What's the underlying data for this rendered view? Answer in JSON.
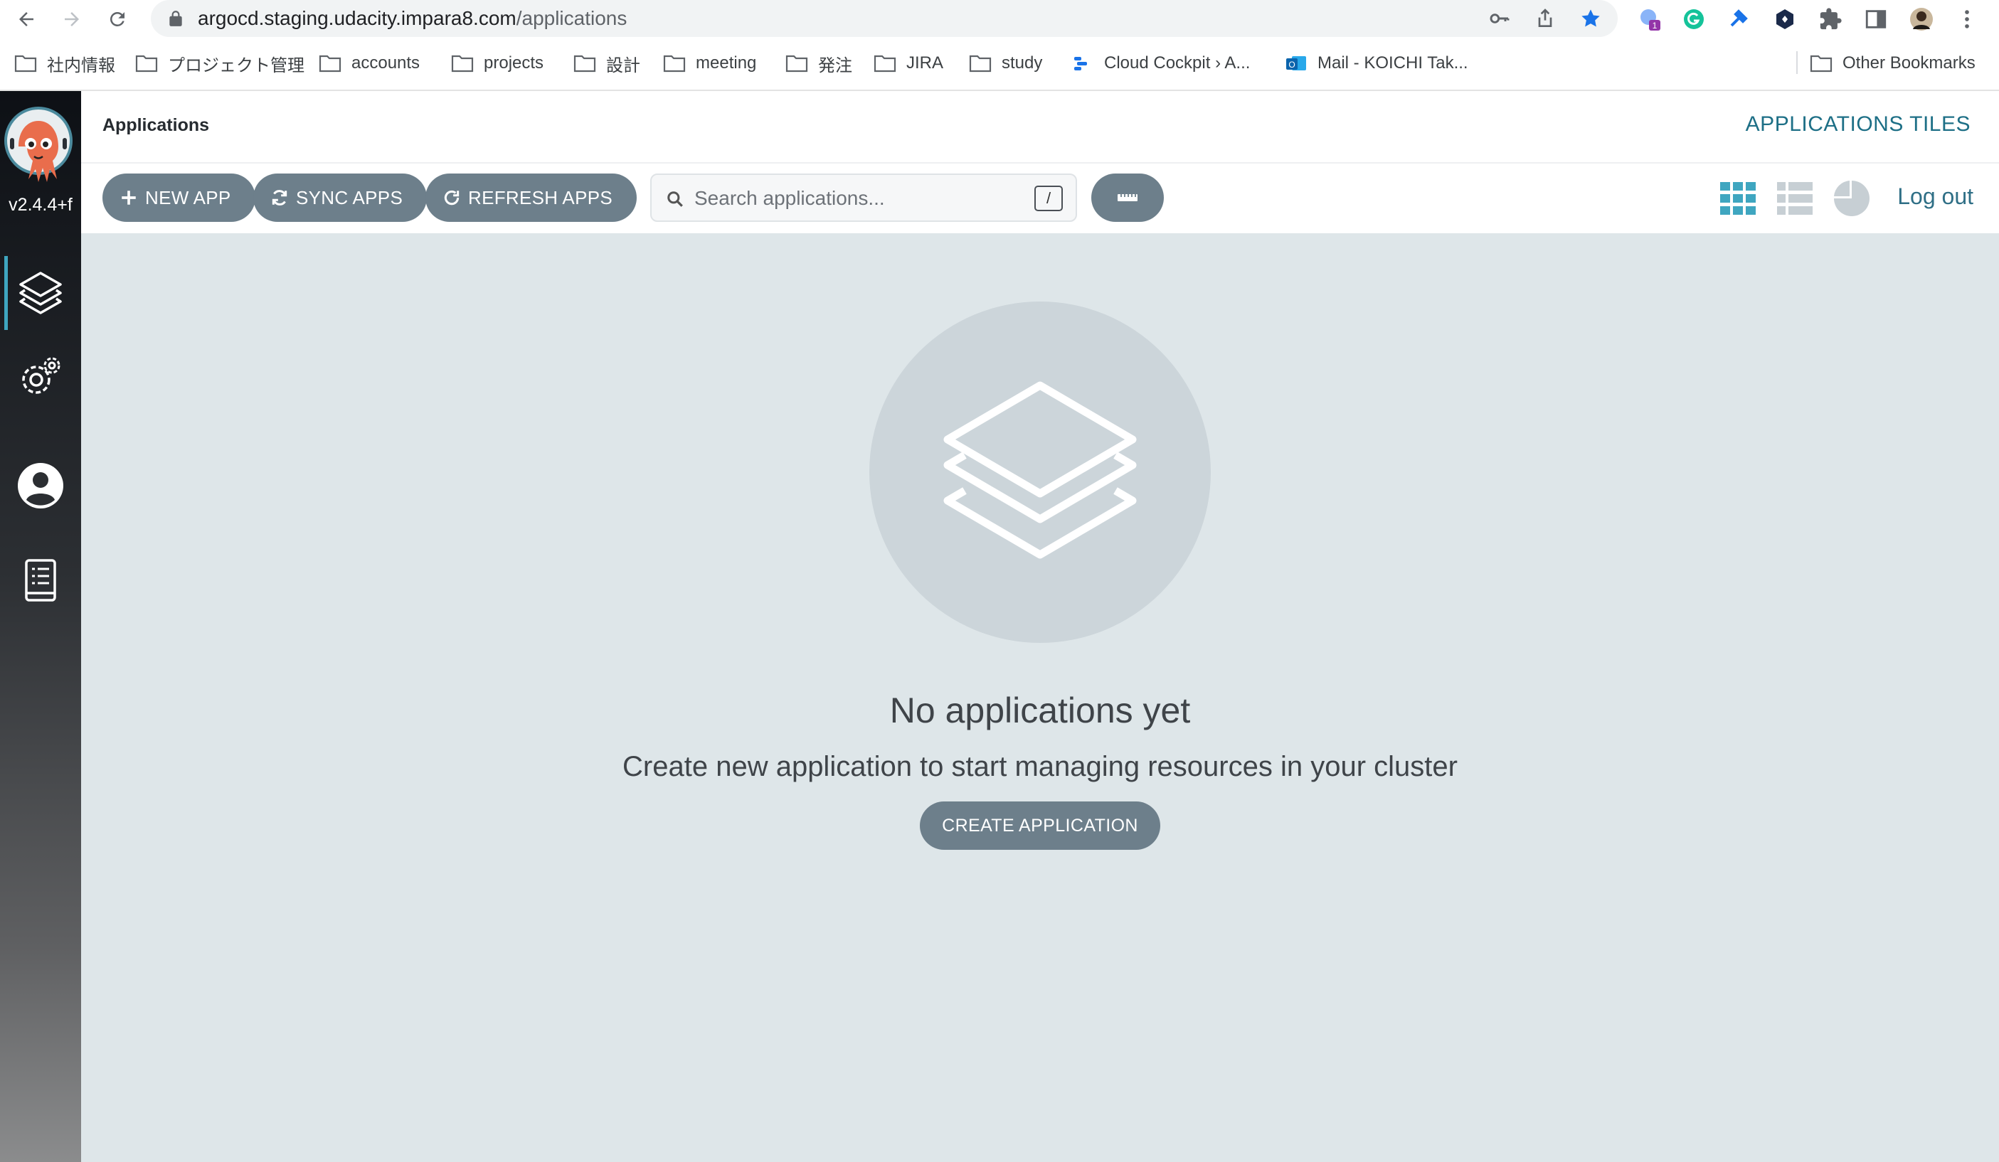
{
  "browser": {
    "url_host": "argocd.staging.udacity.impara8.com",
    "url_path": "/applications",
    "bookmarks": [
      {
        "label": "社内情報",
        "icon": "folder-icon"
      },
      {
        "label": "プロジェクト管理",
        "icon": "folder-icon"
      },
      {
        "label": "accounts",
        "icon": "folder-icon"
      },
      {
        "label": "projects",
        "icon": "folder-icon"
      },
      {
        "label": "設計",
        "icon": "folder-icon"
      },
      {
        "label": "meeting",
        "icon": "folder-icon"
      },
      {
        "label": "発注",
        "icon": "folder-icon"
      },
      {
        "label": "JIRA",
        "icon": "folder-icon"
      },
      {
        "label": "study",
        "icon": "folder-icon"
      },
      {
        "label": "Cloud Cockpit › A...",
        "icon": "cloud-cockpit-icon"
      },
      {
        "label": "Mail - KOICHI Tak...",
        "icon": "outlook-icon"
      }
    ],
    "other_bookmarks": "Other Bookmarks",
    "extension_badge": "1",
    "colors": {
      "star": "#1a73e8"
    }
  },
  "sidebar": {
    "version": "v2.4.4+f",
    "items": [
      {
        "name": "applications",
        "icon": "layers-icon",
        "active": true
      },
      {
        "name": "settings",
        "icon": "gears-icon",
        "active": false
      },
      {
        "name": "user-info",
        "icon": "user-circle-icon",
        "active": false
      },
      {
        "name": "documentation",
        "icon": "book-icon",
        "active": false
      }
    ]
  },
  "header": {
    "breadcrumb": "Applications",
    "title": "APPLICATIONS TILES"
  },
  "toolbar": {
    "new_app": "NEW APP",
    "sync_apps": "SYNC APPS",
    "refresh_apps": "REFRESH APPS",
    "search_placeholder": "Search applications...",
    "search_shortcut": "/",
    "logout": "Log out",
    "views": [
      "tiles-view-icon",
      "list-view-icon",
      "summary-view-icon"
    ]
  },
  "empty_state": {
    "title": "No applications yet",
    "description": "Create new application to start managing resources in your cluster",
    "button": "CREATE APPLICATION"
  },
  "colors": {
    "accent": "#3fa6c0",
    "button": "#6d7f8b",
    "content_bg": "#dee6e9",
    "title_text": "#1d6f86"
  }
}
